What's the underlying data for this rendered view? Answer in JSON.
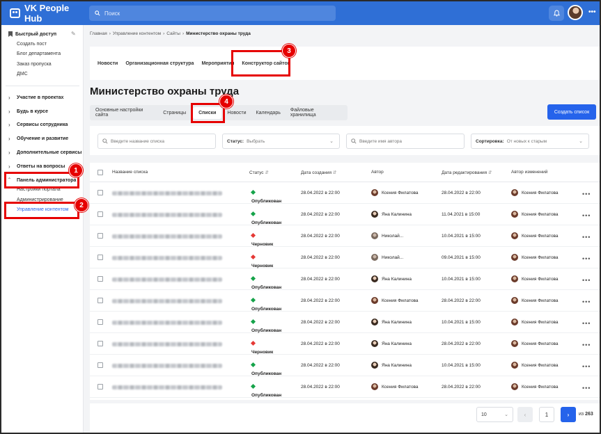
{
  "app": {
    "name": "VK People Hub"
  },
  "search": {
    "placeholder": "Поиск"
  },
  "sidebar": {
    "quick_access": "Быстрый доступ",
    "quick_items": [
      "Создать пост",
      "Блог департамента",
      "Заказ пропуска",
      "ДМС"
    ],
    "sections": [
      "Участие в проектах",
      "Будь в курсе",
      "Сервисы сотрудника",
      "Обучение и развитие",
      "Дополнительные сервисы",
      "Ответы на вопросы"
    ],
    "admin_panel": "Панель администратора",
    "admin_items": [
      "Настройки портала",
      "Администрирование",
      "Управление контентом"
    ]
  },
  "breadcrumb": [
    "Главная",
    "Управление контентом",
    "Сайты",
    "Министерство охраны труда"
  ],
  "topnav": [
    "Новости",
    "Организационная структура",
    "Мероприятия",
    "Конструктор сайтов"
  ],
  "page_title": "Министерство охраны труда",
  "tabs": [
    "Основные настройки сайта",
    "Страницы",
    "Списки",
    "Новости",
    "Календарь",
    "Файловые хранилища"
  ],
  "create_button": "Создать список",
  "filters": {
    "name_placeholder": "Введите название списка",
    "status_label": "Статус:",
    "status_value": "Выбрать",
    "author_placeholder": "Введите имя автора",
    "sort_label": "Сортировка:",
    "sort_value": "От новых к старым"
  },
  "table": {
    "columns": [
      "Название списка",
      "Статус",
      "Дата создания",
      "Автор",
      "Дата редактирования",
      "Автор изменений"
    ],
    "rows": [
      {
        "status": "Опубликован",
        "created": "28.04.2022 в 22:00",
        "author": "Ксения Филатова",
        "edited": "28.04.2022 в 22:00",
        "editor": "Ксения Филатова"
      },
      {
        "status": "Опубликован",
        "created": "28.04.2022 в 22:00",
        "author": "Яна Калинина",
        "edited": "11.04.2021 в 15:00",
        "editor": "Ксения Филатова"
      },
      {
        "status": "Черновик",
        "created": "28.04.2022 в 22:00",
        "author": "Николай...",
        "edited": "10.04.2021 в 15:00",
        "editor": "Ксения Филатова"
      },
      {
        "status": "Черновик",
        "created": "28.04.2022 в 22:00",
        "author": "Николай...",
        "edited": "09.04.2021 в 15:00",
        "editor": "Ксения Филатова"
      },
      {
        "status": "Опубликован",
        "created": "28.04.2022 в 22:00",
        "author": "Яна Калинина",
        "edited": "10.04.2021 в 15:00",
        "editor": "Ксения Филатова"
      },
      {
        "status": "Опубликован",
        "created": "28.04.2022 в 22:00",
        "author": "Ксения Филатова",
        "edited": "28.04.2022 в 22:00",
        "editor": "Ксения Филатова"
      },
      {
        "status": "Опубликован",
        "created": "28.04.2022 в 22:00",
        "author": "Яна Калинина",
        "edited": "10.04.2021 в 15:00",
        "editor": "Ксения Филатова"
      },
      {
        "status": "Черновик",
        "created": "28.04.2022 в 22:00",
        "author": "Яна Калинина",
        "edited": "28.04.2022 в 22:00",
        "editor": "Ксения Филатова"
      },
      {
        "status": "Опубликован",
        "created": "28.04.2022 в 22:00",
        "author": "Яна Калинина",
        "edited": "10.04.2021 в 15:00",
        "editor": "Ксения Филатова"
      },
      {
        "status": "Опубликован",
        "created": "28.04.2022 в 22:00",
        "author": "Ксения Филатова",
        "edited": "28.04.2022 в 22:00",
        "editor": "Ксения Филатова"
      }
    ]
  },
  "pagination": {
    "per_page": "10",
    "current_page": "1",
    "of_label": "из",
    "total": "263"
  },
  "callouts": [
    "1",
    "2",
    "3",
    "4"
  ],
  "colors": {
    "accent": "#2563eb",
    "published": "#16a34a",
    "draft": "#e53935",
    "callout": "#e60000"
  }
}
